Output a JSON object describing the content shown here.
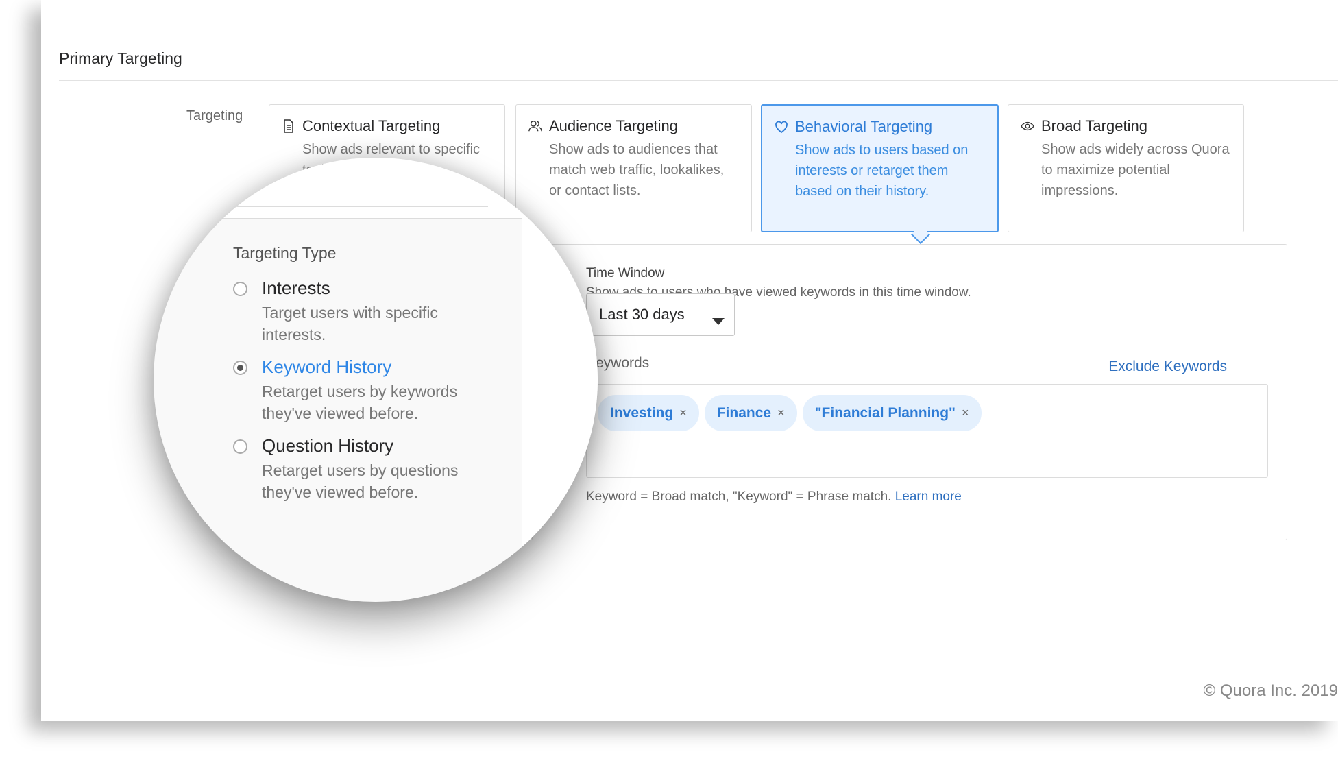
{
  "section": {
    "title": "Primary Targeting",
    "field_label": "Targeting"
  },
  "cards": [
    {
      "title": "Contextual Targeting",
      "icon": "document-icon",
      "description": "Show ads relevant to specific topics, keywords,"
    },
    {
      "title": "Audience Targeting",
      "icon": "people-icon",
      "description": "Show ads to audiences that match web traffic, lookalikes, or contact lists."
    },
    {
      "title": "Behavioral Targeting",
      "icon": "heart-icon",
      "description": "Show ads to users based on interests or retarget them based on their history.",
      "selected": true
    },
    {
      "title": "Broad Targeting",
      "icon": "eye-icon",
      "description": "Show ads widely across Quora to maximize potential impressions."
    }
  ],
  "time_window": {
    "label": "Time Window",
    "help": "Show ads to users who have viewed keywords in this time window.",
    "selected": "Last 30 days"
  },
  "keywords": {
    "label": "Keywords",
    "exclude_label": "Exclude Keywords",
    "chips": [
      "Investing",
      "Finance",
      "\"Financial Planning\""
    ],
    "remove_glyph": "×",
    "hint": "Keyword = Broad match, \"Keyword\" = Phrase match.",
    "hint_link": "Learn more"
  },
  "magnifier": {
    "title": "Targeting Type",
    "options": [
      {
        "label": "Interests",
        "description": "Target users with specific interests.",
        "checked": false
      },
      {
        "label": "Keyword History",
        "description": "Retarget users by keywords they've viewed before.",
        "checked": true
      },
      {
        "label": "Question History",
        "description": "Retarget users by questions they've viewed before.",
        "checked": false
      }
    ]
  },
  "footer": {
    "copyright": "© Quora Inc. 2019"
  },
  "colors": {
    "accent": "#2e7cd6",
    "selected_bg": "#eaf3ff",
    "chip_bg": "#e4f0fd",
    "link": "#2e6fbf"
  }
}
